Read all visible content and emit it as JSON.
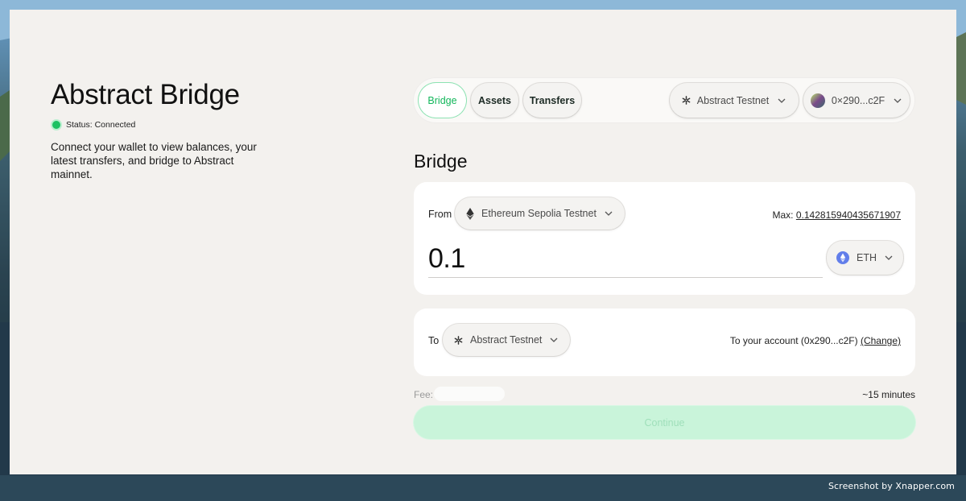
{
  "app": {
    "title": "Abstract Bridge",
    "status": "Status: Connected",
    "description": "Connect your wallet to view balances, your latest transfers, and bridge to Abstract mainnet."
  },
  "nav": {
    "tabs": [
      {
        "label": "Bridge",
        "active": true
      },
      {
        "label": "Assets",
        "active": false
      },
      {
        "label": "Transfers",
        "active": false
      }
    ],
    "network": "Abstract Testnet",
    "wallet": "0×290...c2F"
  },
  "bridge": {
    "title": "Bridge",
    "from_label": "From",
    "from_network": "Ethereum Sepolia Testnet",
    "max_label": "Max:",
    "max_value": "0.142815940435671907",
    "amount": "0.1",
    "token": "ETH",
    "to_label": "To",
    "to_network": "Abstract Testnet",
    "account_text": "To your account (0x290...c2F)",
    "change_label": "(Change)",
    "fee_label": "Fee:",
    "eta": "~15 minutes",
    "continue_label": "Continue"
  },
  "footer": {
    "credit": "Screenshot by Xnapper.com"
  },
  "colors": {
    "accent": "#12b65a",
    "status_dot": "#1cc162",
    "window_bg": "#f3f1ee",
    "continue_bg": "#c9f4da",
    "eth_icon": "#627eea"
  }
}
